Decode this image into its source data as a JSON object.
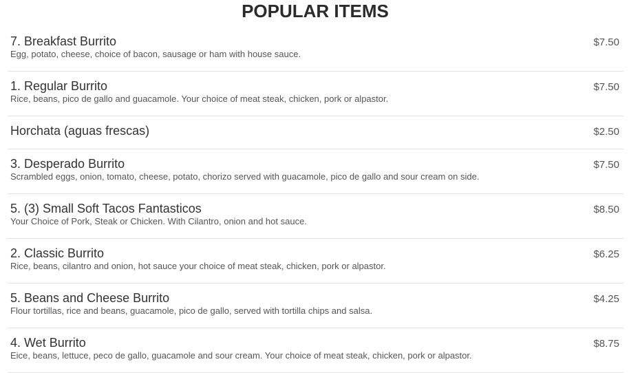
{
  "section": {
    "title": "POPULAR ITEMS"
  },
  "items": [
    {
      "name": "7. Breakfast Burrito",
      "description": "Egg, potato, cheese, choice of bacon, sausage or ham with house sauce.",
      "price": "$7.50"
    },
    {
      "name": "1. Regular Burrito",
      "description": "Rice, beans, pico de gallo and guacamole. Your choice of meat steak, chicken, pork or alpastor.",
      "price": "$7.50"
    },
    {
      "name": "Horchata (aguas frescas)",
      "description": "",
      "price": "$2.50"
    },
    {
      "name": "3. Desperado Burrito",
      "description": "Scrambled eggs, onion, tomato, cheese, potato, chorizo served with guacamole, pico de gallo and sour cream on side.",
      "price": "$7.50"
    },
    {
      "name": "5. (3) Small Soft Tacos Fantasticos",
      "description": "Your Choice of Pork, Steak or Chicken. With Cilantro, onion and hot sauce.",
      "price": "$8.50"
    },
    {
      "name": "2. Classic Burrito",
      "description": "Rice, beans, cilantro and onion, hot sauce your choice of meat steak, chicken, pork or alpastor.",
      "price": "$6.25"
    },
    {
      "name": "5. Beans and Cheese Burrito",
      "description": "Flour tortillas, rice and beans, guacamole, pico de gallo, served with tortilla chips and salsa.",
      "price": "$4.25"
    },
    {
      "name": "4. Wet Burrito",
      "description": "Eice, beans, lettuce, peco de gallo, guacamole and sour cream. Your choice of meat steak, chicken, pork or alpastor.",
      "price": "$8.75"
    }
  ]
}
